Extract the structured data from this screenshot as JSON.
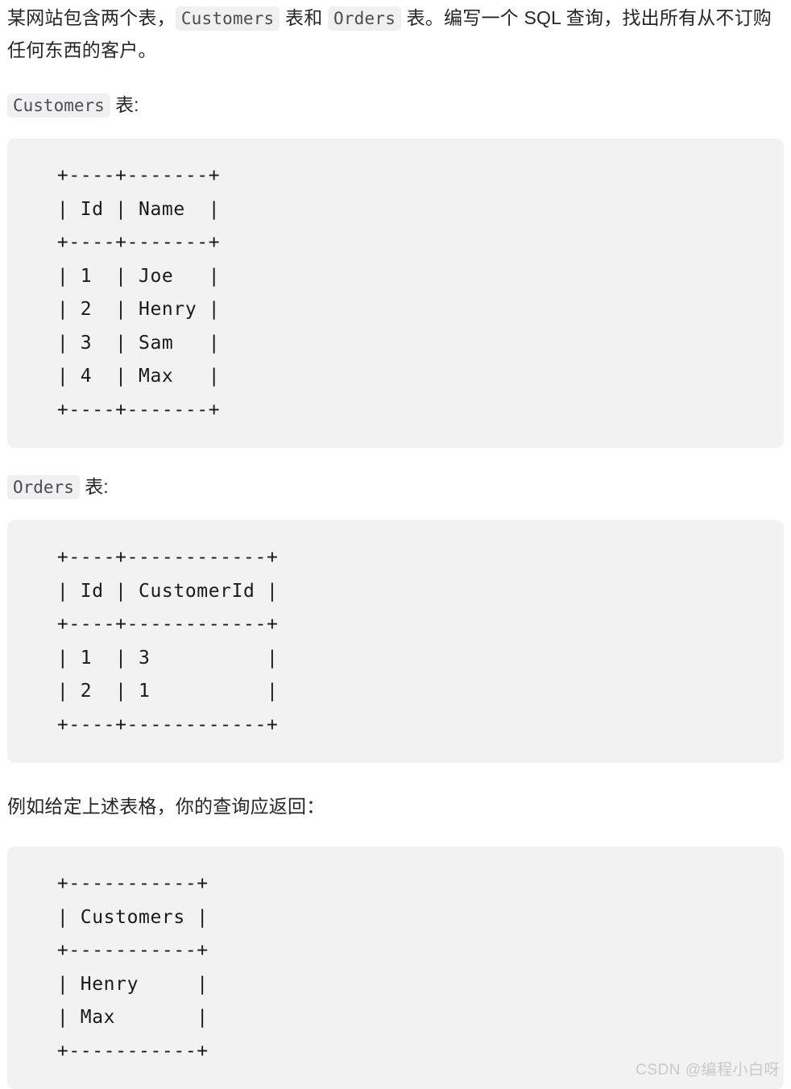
{
  "intro": {
    "text_before_code1": "某网站包含两个表，",
    "code1": "Customers",
    "text_between": " 表和 ",
    "code2": "Orders",
    "text_after": " 表。编写一个 SQL 查询，找出所有从不订购任何东西的客户。"
  },
  "sections": [
    {
      "label_code": "Customers",
      "label_suffix": " 表:",
      "code_block": "  +----+-------+\n  | Id | Name  |\n  +----+-------+\n  | 1  | Joe   |\n  | 2  | Henry |\n  | 3  | Sam   |\n  | 4  | Max   |\n  +----+-------+",
      "table": {
        "columns": [
          "Id",
          "Name"
        ],
        "rows": [
          [
            "1",
            "Joe"
          ],
          [
            "2",
            "Henry"
          ],
          [
            "3",
            "Sam"
          ],
          [
            "4",
            "Max"
          ]
        ]
      }
    },
    {
      "label_code": "Orders",
      "label_suffix": " 表:",
      "code_block": "  +----+------------+\n  | Id | CustomerId |\n  +----+------------+\n  | 1  | 3          |\n  | 2  | 1          |\n  +----+------------+",
      "table": {
        "columns": [
          "Id",
          "CustomerId"
        ],
        "rows": [
          [
            "1",
            "3"
          ],
          [
            "2",
            "1"
          ]
        ]
      }
    }
  ],
  "example": {
    "paragraph": "例如给定上述表格，你的查询应返回：",
    "code_block": "  +-----------+\n  | Customers |\n  +-----------+\n  | Henry     |\n  | Max       |\n  +-----------+",
    "table": {
      "columns": [
        "Customers"
      ],
      "rows": [
        [
          "Henry"
        ],
        [
          "Max"
        ]
      ]
    }
  },
  "watermark": "CSDN @编程小白呀",
  "colors": {
    "code_block_bg": "#f2f2f3",
    "inline_code_bg": "#f0f0f2",
    "text": "#262626",
    "watermark": "#c9c9cd"
  }
}
